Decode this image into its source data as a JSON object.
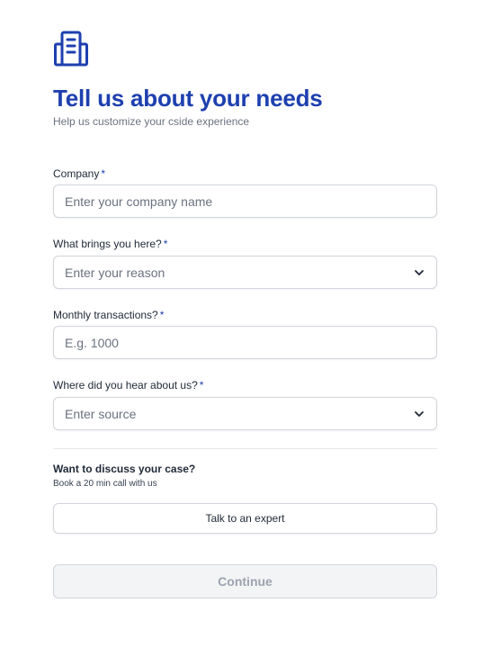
{
  "header": {
    "logo_icon": "building-icon",
    "title": "Tell us about your needs",
    "subtitle": "Help us customize your cside experience"
  },
  "form": {
    "company": {
      "label": "Company",
      "required": "*",
      "placeholder": "Enter your company name"
    },
    "reason": {
      "label": "What brings you here?",
      "required": "*",
      "placeholder": "Enter your reason",
      "icon": "chevron-down-icon"
    },
    "transactions": {
      "label": "Monthly transactions?",
      "required": "*",
      "placeholder": "E.g. 1000"
    },
    "source": {
      "label": "Where did you hear about us?",
      "required": "*",
      "placeholder": "Enter source",
      "icon": "chevron-down-icon"
    }
  },
  "discuss": {
    "title": "Want to discuss your case?",
    "subtitle": "Book a 20 min call with us",
    "button_label": "Talk to an expert"
  },
  "continue_label": "Continue",
  "colors": {
    "accent": "#1e40af",
    "muted_text": "#6b7280",
    "border": "#d1d5db",
    "disabled_bg": "#f3f4f6",
    "disabled_text": "#9ca3af"
  }
}
